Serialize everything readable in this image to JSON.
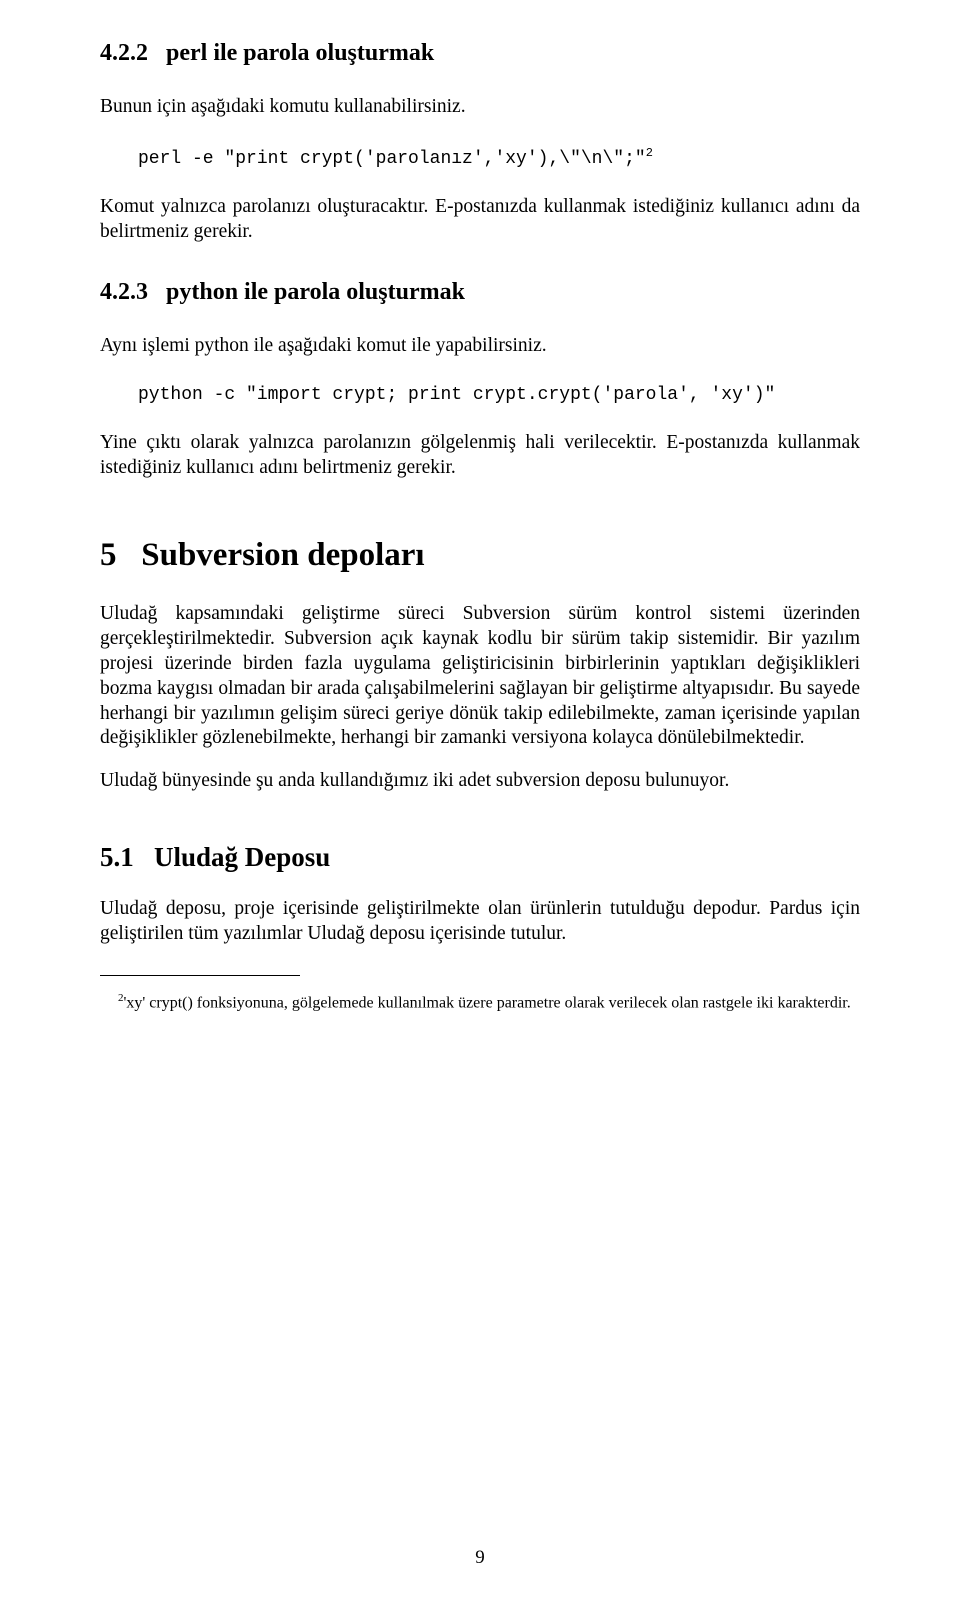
{
  "s422": {
    "heading_num": "4.2.2",
    "heading_text": "perl ile parola oluşturmak",
    "p1": "Bunun için aşağıdaki komutu kullanabilirsiniz.",
    "code": "perl -e \"print crypt('parolanız','xy'),\\\"\\n\\\";\"",
    "code_sup": "2",
    "p2": "Komut yalnızca parolanızı oluşturacaktır. E-postanızda kullanmak istediğiniz kullanıcı adını da belirtmeniz gerekir."
  },
  "s423": {
    "heading_num": "4.2.3",
    "heading_text": "python ile parola oluşturmak",
    "p1": "Aynı işlemi python ile aşağıdaki komut ile yapabilirsiniz.",
    "code": "python -c \"import crypt; print crypt.crypt('parola', 'xy')\"",
    "p2": "Yine çıktı olarak yalnızca parolanızın gölgelenmiş hali verilecektir. E-postanızda kullanmak istediğiniz kullanıcı adını belirtmeniz gerekir."
  },
  "s5": {
    "heading_num": "5",
    "heading_text": "Subversion depoları",
    "p1": "Uludağ kapsamındaki geliştirme süreci Subversion sürüm kontrol sistemi üzerinden gerçekleştirilmektedir. Subversion açık kaynak kodlu bir sürüm takip sistemidir. Bir yazılım projesi üzerinde birden fazla uygulama geliştiricisinin birbirlerinin yaptıkları değişiklikleri bozma kaygısı olmadan bir arada çalışabilmelerini sağlayan bir geliştirme altyapısıdır. Bu sayede herhangi bir yazılımın gelişim süreci geriye dönük takip edilebilmekte, zaman içerisinde yapılan değişiklikler gözlenebilmekte, herhangi bir zamanki versiyona kolayca dönülebilmektedir.",
    "p2": "Uludağ bünyesinde şu anda kullandığımız iki adet subversion deposu bulunuyor."
  },
  "s51": {
    "heading_num": "5.1",
    "heading_text": "Uludağ Deposu",
    "p1": "Uludağ deposu, proje içerisinde geliştirilmekte olan ürünlerin tutulduğu depodur. Pardus için geliştirilen tüm yazılımlar Uludağ deposu içerisinde tutulur."
  },
  "footnote": {
    "num": "2",
    "text": "'xy' crypt() fonksiyonuna, gölgelemede kullanılmak üzere parametre olarak verilecek olan rastgele iki karakterdir."
  },
  "page_number": "9"
}
